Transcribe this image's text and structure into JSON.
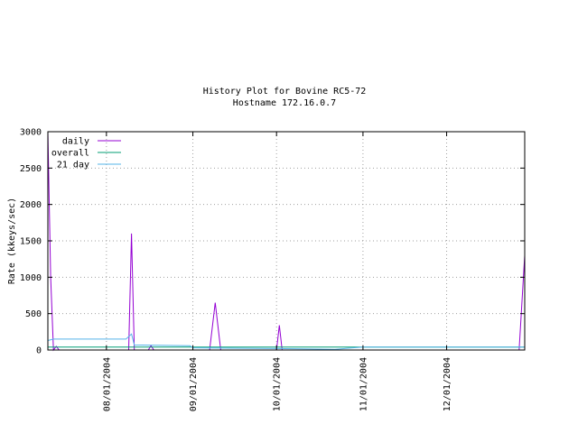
{
  "chart_data": {
    "type": "line",
    "title": "History Plot for Bovine RC5-72",
    "subtitle": "Hostname 172.16.0.7",
    "xlabel": "",
    "ylabel": "Rate (kkeys/sec)",
    "ylim": [
      0,
      3000
    ],
    "xlim": [
      "2004-07-11",
      "2004-12-29"
    ],
    "yticks": [
      0,
      500,
      1000,
      1500,
      2000,
      2500,
      3000
    ],
    "xticks": [
      {
        "date": "2004-08-01",
        "label": "08/01/2004"
      },
      {
        "date": "2004-09-01",
        "label": "09/01/2004"
      },
      {
        "date": "2004-10-01",
        "label": "10/01/2004"
      },
      {
        "date": "2004-11-01",
        "label": "11/01/2004"
      },
      {
        "date": "2004-12-01",
        "label": "12/01/2004"
      }
    ],
    "grid": true,
    "legend_position": "top-left",
    "series": [
      {
        "name": "daily",
        "color": "#9400d3",
        "points": [
          [
            "2004-07-11",
            3000
          ],
          [
            "2004-07-12",
            1000
          ],
          [
            "2004-07-13",
            0
          ],
          [
            "2004-07-14",
            50
          ],
          [
            "2004-07-15",
            0
          ],
          [
            "2004-07-31",
            0
          ],
          [
            "2004-08-01",
            0
          ],
          [
            "2004-08-09",
            0
          ],
          [
            "2004-08-10",
            1600
          ],
          [
            "2004-08-11",
            0
          ],
          [
            "2004-08-16",
            0
          ],
          [
            "2004-08-17",
            60
          ],
          [
            "2004-08-18",
            0
          ],
          [
            "2004-09-07",
            0
          ],
          [
            "2004-09-09",
            650
          ],
          [
            "2004-09-11",
            0
          ],
          [
            "2004-10-01",
            0
          ],
          [
            "2004-10-02",
            340
          ],
          [
            "2004-10-03",
            0
          ],
          [
            "2004-10-22",
            0
          ],
          [
            "2004-12-27",
            0
          ],
          [
            "2004-12-29",
            1300
          ]
        ]
      },
      {
        "name": "overall",
        "color": "#009e73",
        "points": [
          [
            "2004-07-11",
            40
          ],
          [
            "2004-08-10",
            40
          ],
          [
            "2004-09-01",
            40
          ],
          [
            "2004-10-01",
            40
          ],
          [
            "2004-11-01",
            40
          ],
          [
            "2004-12-01",
            40
          ],
          [
            "2004-12-29",
            40
          ]
        ]
      },
      {
        "name": "21 day",
        "color": "#56b4e9",
        "points": [
          [
            "2004-07-11",
            130
          ],
          [
            "2004-07-13",
            150
          ],
          [
            "2004-08-08",
            150
          ],
          [
            "2004-08-10",
            220
          ],
          [
            "2004-08-11",
            70
          ],
          [
            "2004-08-31",
            60
          ],
          [
            "2004-09-01",
            30
          ],
          [
            "2004-10-01",
            20
          ],
          [
            "2004-10-22",
            10
          ],
          [
            "2004-11-01",
            40
          ],
          [
            "2004-12-29",
            40
          ]
        ]
      }
    ]
  }
}
